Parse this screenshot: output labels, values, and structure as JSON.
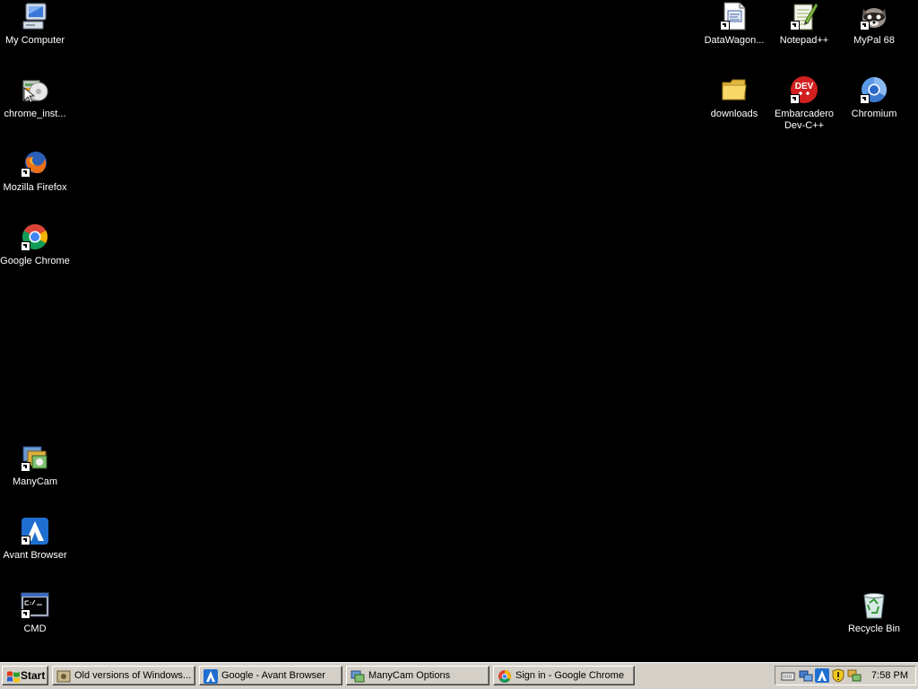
{
  "desktop": {
    "icons": [
      {
        "label": "My Computer",
        "icon": "my-computer-icon"
      },
      {
        "label": "chrome_inst...",
        "icon": "installer-icon"
      },
      {
        "label": "Mozilla Firefox",
        "icon": "firefox-icon"
      },
      {
        "label": "Google Chrome",
        "icon": "chrome-icon"
      },
      {
        "label": "ManyCam",
        "icon": "manycam-icon"
      },
      {
        "label": "Avant Browser",
        "icon": "avant-browser-icon"
      },
      {
        "label": "CMD",
        "icon": "cmd-icon"
      },
      {
        "label": "DataWagon...",
        "icon": "document-icon"
      },
      {
        "label": "Notepad++",
        "icon": "notepad-plus-plus-icon"
      },
      {
        "label": "MyPal 68",
        "icon": "mypal-icon"
      },
      {
        "label": "downloads",
        "icon": "folder-icon"
      },
      {
        "label": "Embarcadero Dev-C++",
        "icon": "dev-cpp-icon"
      },
      {
        "label": "Chromium",
        "icon": "chromium-icon"
      },
      {
        "label": "Recycle Bin",
        "icon": "recycle-bin-icon"
      }
    ],
    "dev_badge_text": "DEV"
  },
  "taskbar": {
    "start_label": "Start",
    "buttons": [
      {
        "label": "Old versions of Windows...",
        "icon": "explorer-icon"
      },
      {
        "label": "Google - Avant Browser",
        "icon": "avant-browser-icon"
      },
      {
        "label": "ManyCam Options",
        "icon": "manycam-icon"
      },
      {
        "label": "Sign in - Google Chrome",
        "icon": "chrome-icon"
      }
    ],
    "tray_icons": [
      "keyboard-icon",
      "network-icon",
      "avant-browser-icon",
      "security-shield-icon",
      "manycam-icon"
    ],
    "clock": "7:58 PM"
  },
  "colors": {
    "desktop_background": "#000000",
    "taskbar": "#d4d0c8"
  }
}
